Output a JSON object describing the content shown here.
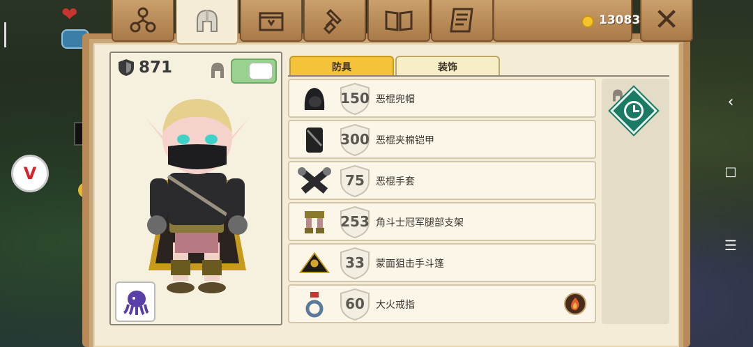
{
  "currency": {
    "coins": "13083"
  },
  "top_tabs": [
    {
      "name": "group-tab"
    },
    {
      "name": "armor-tab",
      "active": true
    },
    {
      "name": "chest-tab"
    },
    {
      "name": "craft-tab"
    },
    {
      "name": "map-tab"
    },
    {
      "name": "scroll-tab"
    }
  ],
  "character": {
    "armor_total": "871",
    "appearance_toggle": true
  },
  "sub_tabs": {
    "armor": "防具",
    "decor": "装饰"
  },
  "items": [
    {
      "armor": "150",
      "name": "恶棍兜帽",
      "icon": "hood-icon"
    },
    {
      "armor": "300",
      "name": "恶棍夹棉铠甲",
      "icon": "padded-armor-icon"
    },
    {
      "armor": "75",
      "name": "恶棍手套",
      "icon": "gloves-icon"
    },
    {
      "armor": "253",
      "name": "角斗士冠军腿部支架",
      "icon": "leg-brace-icon"
    },
    {
      "armor": "33",
      "name": "蒙面狙击手斗篷",
      "icon": "cloak-icon"
    },
    {
      "armor": "60",
      "name": "大火戒指",
      "icon": "ring-icon"
    }
  ],
  "colors": {
    "active_tab": "#f4c33a",
    "panel_bg": "#f4ecd6",
    "toggle_on": "#9ad090",
    "badge": "#1b7a64"
  }
}
